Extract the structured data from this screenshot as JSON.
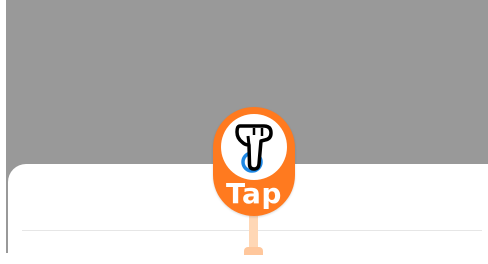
{
  "tap_indicator": {
    "label": "Tap",
    "icon": "pointing-hand-icon",
    "colors": {
      "badge": "#ff7a1f",
      "touch_ring": "#1e88e5",
      "tail": "#ffd7b5"
    }
  },
  "colors": {
    "backdrop": "#999999",
    "sheet": "#ffffff"
  }
}
